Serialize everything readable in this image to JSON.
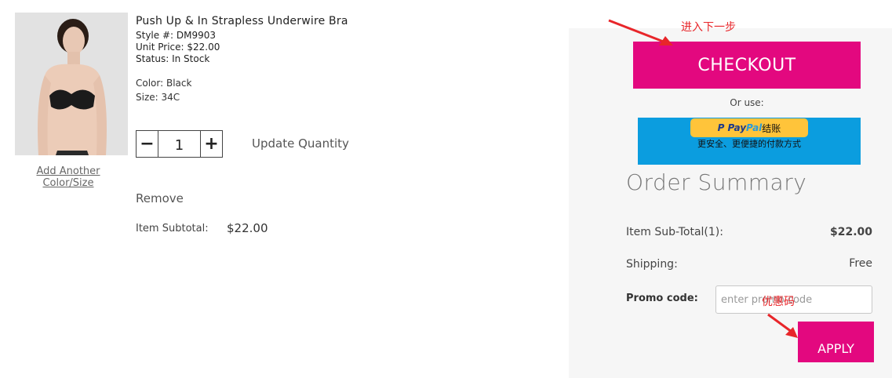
{
  "product": {
    "name": "Push Up & In Strapless Underwire Bra",
    "style": "Style #: DM9903",
    "unit_price": "Unit Price: $22.00",
    "status": "Status: In Stock",
    "color": "Color: Black",
    "size": "Size: 34C",
    "add_another_line1": "Add Another",
    "add_another_line2": "Color/Size"
  },
  "quantity": {
    "minus": "−",
    "value": "1",
    "plus": "+",
    "update_label": "Update Quantity"
  },
  "remove_label": "Remove",
  "item_subtotal": {
    "label": "Item Subtotal:",
    "value": "$22.00"
  },
  "checkout": {
    "label": "CHECKOUT",
    "annotation": "进入下一步",
    "or_use": "Or use:"
  },
  "paypal": {
    "brand_pay": "Pay",
    "brand_pal": "Pal",
    "button_text": "结账",
    "subtitle": "更安全、更便捷的付款方式"
  },
  "summary": {
    "title": "Order Summary",
    "subtotal_label": "Item Sub-Total(1):",
    "subtotal_value": "$22.00",
    "shipping_label": "Shipping:",
    "shipping_value": "Free",
    "promo_label": "Promo code:",
    "promo_placeholder": "enter promo code",
    "promo_annotation": "优惠码",
    "apply_label": "APPLY"
  },
  "colors": {
    "accent": "#e3087f",
    "annotation": "#e8262a",
    "paypal_bg": "#0b9ddf",
    "paypal_button": "#ffc43a"
  }
}
